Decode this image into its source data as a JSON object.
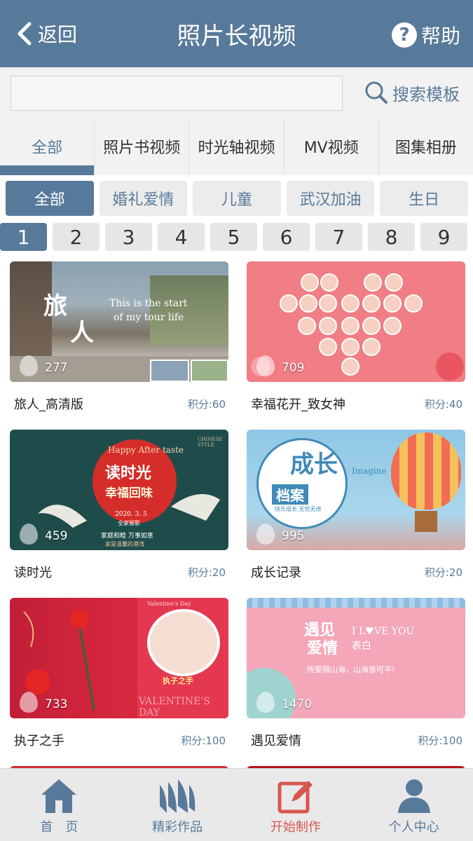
{
  "header": {
    "back_label": "返回",
    "title": "照片长视频",
    "help_label": "帮助"
  },
  "search": {
    "placeholder": "",
    "button_label": "搜索模板"
  },
  "categories": [
    {
      "label": "全部",
      "active": true
    },
    {
      "label": "照片书视频",
      "active": false
    },
    {
      "label": "时光轴视频",
      "active": false
    },
    {
      "label": "MV视频",
      "active": false
    },
    {
      "label": "图集相册",
      "active": false
    }
  ],
  "tags": [
    {
      "label": "全部",
      "active": true
    },
    {
      "label": "婚礼爱情",
      "active": false
    },
    {
      "label": "儿童",
      "active": false
    },
    {
      "label": "武汉加油",
      "active": false
    },
    {
      "label": "生日",
      "active": false
    }
  ],
  "pages": [
    "1",
    "2",
    "3",
    "4",
    "5",
    "6",
    "7",
    "8",
    "9"
  ],
  "current_page": "1",
  "templates": [
    {
      "name": "旅人_高清版",
      "points": "积分:60",
      "views": "277",
      "thumb_text": [
        "旅",
        "人",
        "This is the start",
        "of my tour life"
      ]
    },
    {
      "name": "幸福花开_致女神",
      "points": "积分:40",
      "views": "709",
      "thumb_text": []
    },
    {
      "name": "读时光",
      "points": "积分:20",
      "views": "459",
      "thumb_text": [
        "Happy After taste",
        "读时光",
        "幸福回味",
        "2020. 3. 5",
        "全家留影",
        "家庭和睦 万事如意",
        "家是温馨的港湾",
        "CHINESE STYLE"
      ]
    },
    {
      "name": "成长记录",
      "points": "积分:20",
      "views": "995",
      "thumb_text": [
        "成长",
        "档案",
        "Imagine",
        "快乐成长 无忧无虑"
      ]
    },
    {
      "name": "执子之手",
      "points": "积分:100",
      "views": "733",
      "thumb_text": [
        "执子之手",
        "VALENTINE'S DAY",
        "Valentine's Day"
      ]
    },
    {
      "name": "遇见爱情",
      "points": "积分:100",
      "views": "1470",
      "thumb_text": [
        "遇见",
        "爱情",
        "I L♥VE YOU",
        "表白",
        "所爱隔山海，山海皆可平!"
      ]
    }
  ],
  "bottom_nav": [
    {
      "label": "首　页",
      "icon": "home-icon",
      "active": false
    },
    {
      "label": "精彩作品",
      "icon": "works-icon",
      "active": false
    },
    {
      "label": "开始制作",
      "icon": "edit-icon",
      "active": true
    },
    {
      "label": "个人中心",
      "icon": "user-icon",
      "active": false
    }
  ],
  "colors": {
    "primary": "#587a9a",
    "accent_active": "#d8574f",
    "background": "#f2f2f2"
  }
}
